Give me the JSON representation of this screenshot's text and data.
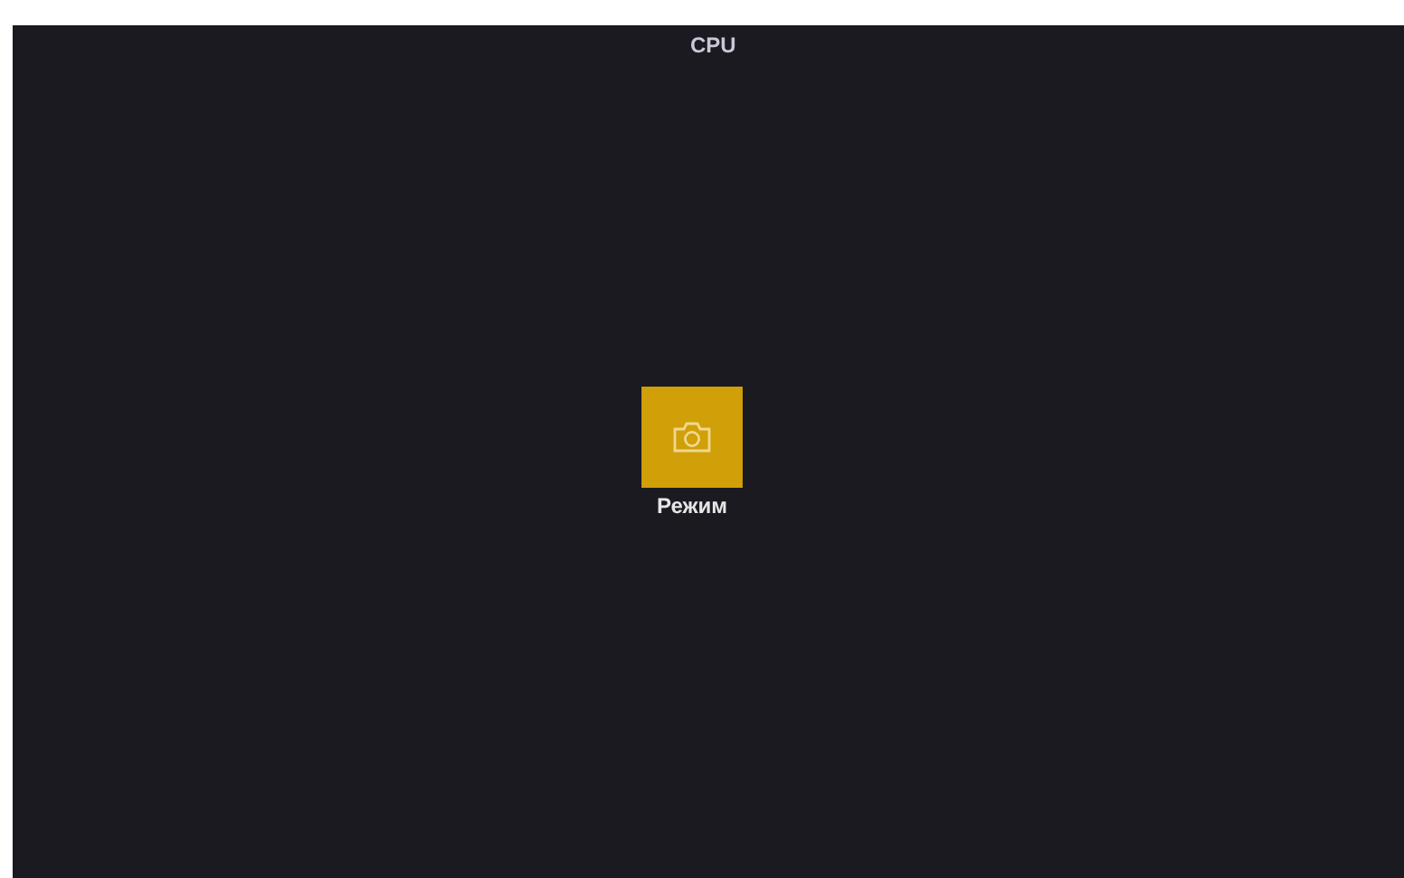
{
  "header": {
    "title": "CPU"
  },
  "apps": [
    {
      "kind": "camera",
      "label": "Режим"
    }
  ]
}
